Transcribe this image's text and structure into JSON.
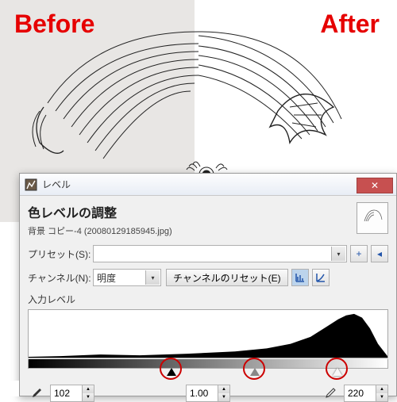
{
  "overlay": {
    "before": "Before",
    "after": "After"
  },
  "dialog": {
    "window_title": "レベル",
    "header_title": "色レベルの調整",
    "header_sub": "背景 コピー-4 (20080129185945.jpg)",
    "preset_label": "プリセット(S):",
    "channel_label": "チャンネル(N):",
    "channel_value": "明度",
    "reset_channel": "チャンネルのリセット(E)",
    "input_levels_label": "入力レベル",
    "plus_icon": "+",
    "back_icon": "◂",
    "inputs": {
      "black": "102",
      "gamma": "1.00",
      "white": "220"
    }
  }
}
